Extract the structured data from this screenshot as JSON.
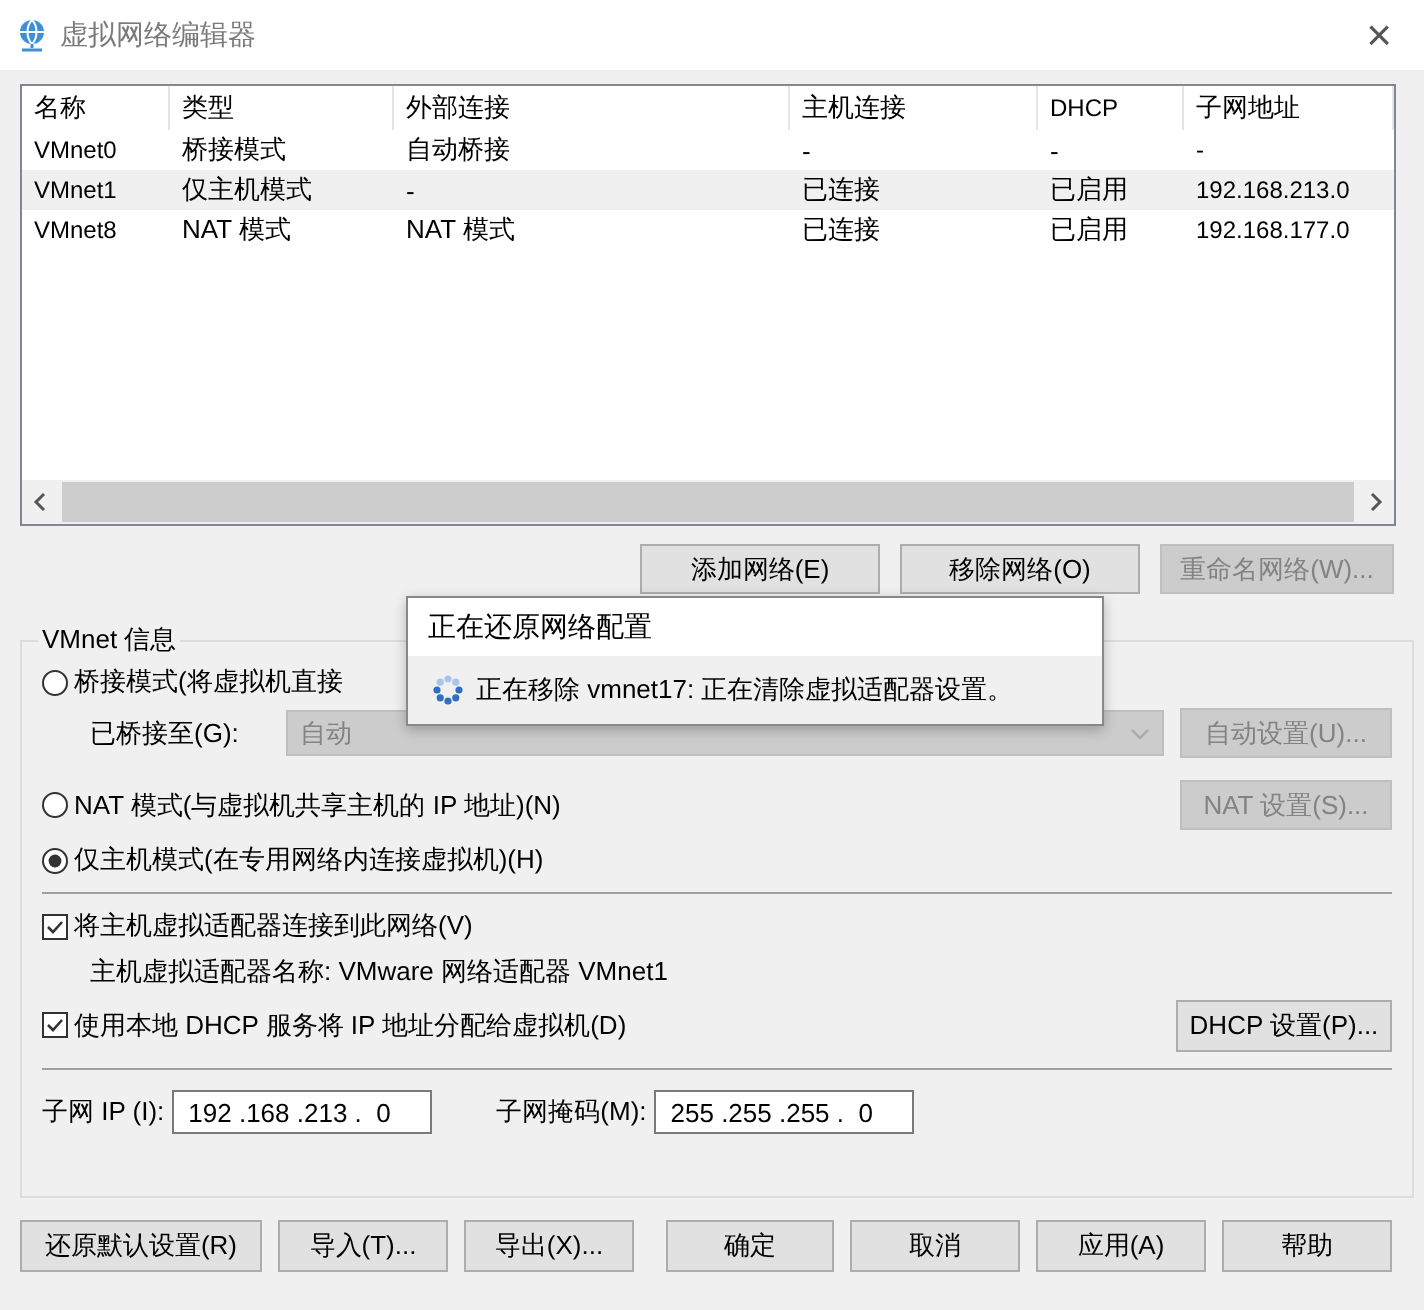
{
  "window": {
    "title": "虚拟网络编辑器",
    "close": "×"
  },
  "table": {
    "columns": [
      "名称",
      "类型",
      "外部连接",
      "主机连接",
      "DHCP",
      "子网地址"
    ],
    "rows": [
      {
        "cells": [
          "VMnet0",
          "桥接模式",
          "自动桥接",
          "-",
          "-",
          "-"
        ],
        "selected": false
      },
      {
        "cells": [
          "VMnet1",
          "仅主机模式",
          "-",
          "已连接",
          "已启用",
          "192.168.213.0"
        ],
        "selected": true
      },
      {
        "cells": [
          "VMnet8",
          "NAT 模式",
          "NAT 模式",
          "已连接",
          "已启用",
          "192.168.177.0"
        ],
        "selected": false
      }
    ]
  },
  "network_buttons": [
    {
      "label": "添加网络(E)",
      "disabled": false
    },
    {
      "label": "移除网络(O)",
      "disabled": false
    },
    {
      "label": "重命名网络(W)...",
      "disabled": true
    }
  ],
  "vmnet_info": {
    "legend": "VMnet 信息",
    "bridged": {
      "label": "桥接模式(将虚拟机直接",
      "selected": false
    },
    "bridged_to": {
      "label": "已桥接至(G):",
      "value": "自动",
      "disabled": true,
      "button": {
        "label": "自动设置(U)...",
        "disabled": true
      }
    },
    "nat": {
      "label": "NAT 模式(与虚拟机共享主机的 IP 地址)(N)",
      "selected": false,
      "button": {
        "label": "NAT 设置(S)...",
        "disabled": true
      }
    },
    "host_only": {
      "label": "仅主机模式(在专用网络内连接虚拟机)(H)",
      "selected": true
    },
    "connect_adapter": {
      "label": "将主机虚拟适配器连接到此网络(V)",
      "checked": true
    },
    "adapter_name": "主机虚拟适配器名称: VMware 网络适配器 VMnet1",
    "dhcp": {
      "label": "使用本地 DHCP 服务将 IP 地址分配给虚拟机(D)",
      "checked": true,
      "button": {
        "label": "DHCP 设置(P)...",
        "disabled": false
      }
    },
    "subnet_ip": {
      "label": "子网 IP (I):",
      "value": "192 .168 .213 .  0"
    },
    "subnet_mask": {
      "label": "子网掩码(M):",
      "value": "255 .255 .255 .  0"
    }
  },
  "footer_buttons": [
    {
      "label": "还原默认设置(R)"
    },
    {
      "label": "导入(T)..."
    },
    {
      "label": "导出(X)..."
    },
    {
      "label": "确定"
    },
    {
      "label": "取消"
    },
    {
      "label": "应用(A)"
    },
    {
      "label": "帮助"
    }
  ],
  "progress_dialog": {
    "title": "正在还原网络配置",
    "message": "正在移除 vmnet17: 正在清除虚拟适配器设置。"
  }
}
